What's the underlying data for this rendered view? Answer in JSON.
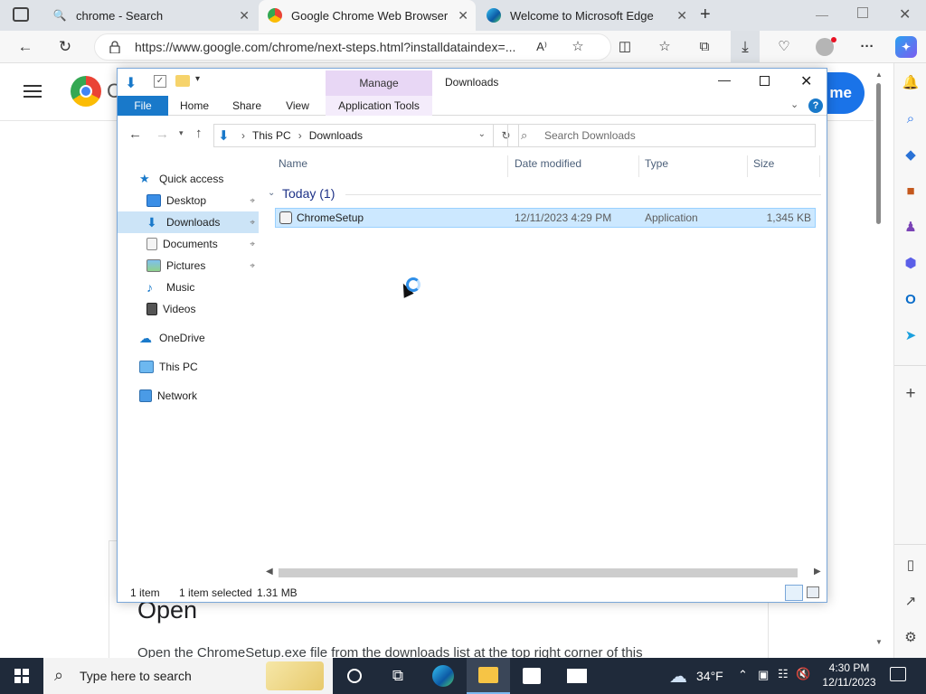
{
  "browser": {
    "tabs": [
      {
        "title": "chrome - Search",
        "icon": "search-icon"
      },
      {
        "title": "Google Chrome Web Browser",
        "icon": "chrome-icon"
      },
      {
        "title": "Welcome to Microsoft Edge",
        "icon": "edge-icon"
      }
    ],
    "url": "https://www.google.com/chrome/next-steps.html?installdataindex=...",
    "page_heading": "Open",
    "page_text": "Open the ChromeSetup.exe file from the downloads list at the top right corner of this",
    "page_button_partial": "me",
    "page_logo_partial": "C"
  },
  "explorer": {
    "title": "Downloads",
    "context_tab": "Manage",
    "ribbon_tabs": [
      "File",
      "Home",
      "Share",
      "View",
      "Application Tools"
    ],
    "breadcrumb": [
      "This PC",
      "Downloads"
    ],
    "search_placeholder": "Search Downloads",
    "nav_items": [
      {
        "label": "Quick access",
        "icon": "star-icon"
      },
      {
        "label": "Desktop",
        "icon": "desktop-icon",
        "pinned": true
      },
      {
        "label": "Downloads",
        "icon": "download-arrow-icon",
        "pinned": true,
        "selected": true
      },
      {
        "label": "Documents",
        "icon": "document-icon",
        "pinned": true
      },
      {
        "label": "Pictures",
        "icon": "picture-icon",
        "pinned": true
      },
      {
        "label": "Music",
        "icon": "music-icon"
      },
      {
        "label": "Videos",
        "icon": "video-icon"
      },
      {
        "label": "OneDrive",
        "icon": "cloud-icon"
      },
      {
        "label": "This PC",
        "icon": "computer-icon"
      },
      {
        "label": "Network",
        "icon": "network-icon"
      }
    ],
    "columns": [
      "Name",
      "Date modified",
      "Type",
      "Size"
    ],
    "group_label": "Today (1)",
    "files": [
      {
        "name": "ChromeSetup",
        "date": "12/11/2023 4:29 PM",
        "type": "Application",
        "size": "1,345 KB"
      }
    ],
    "status": {
      "count": "1 item",
      "selected": "1 item selected",
      "size": "1.31 MB"
    }
  },
  "taskbar": {
    "search_placeholder": "Type here to search",
    "weather": "34°F",
    "time": "4:30 PM",
    "date": "12/11/2023"
  },
  "colors": {
    "accent": "#1979ca",
    "selection": "#cce8ff",
    "manage": "#e8d7f5"
  }
}
